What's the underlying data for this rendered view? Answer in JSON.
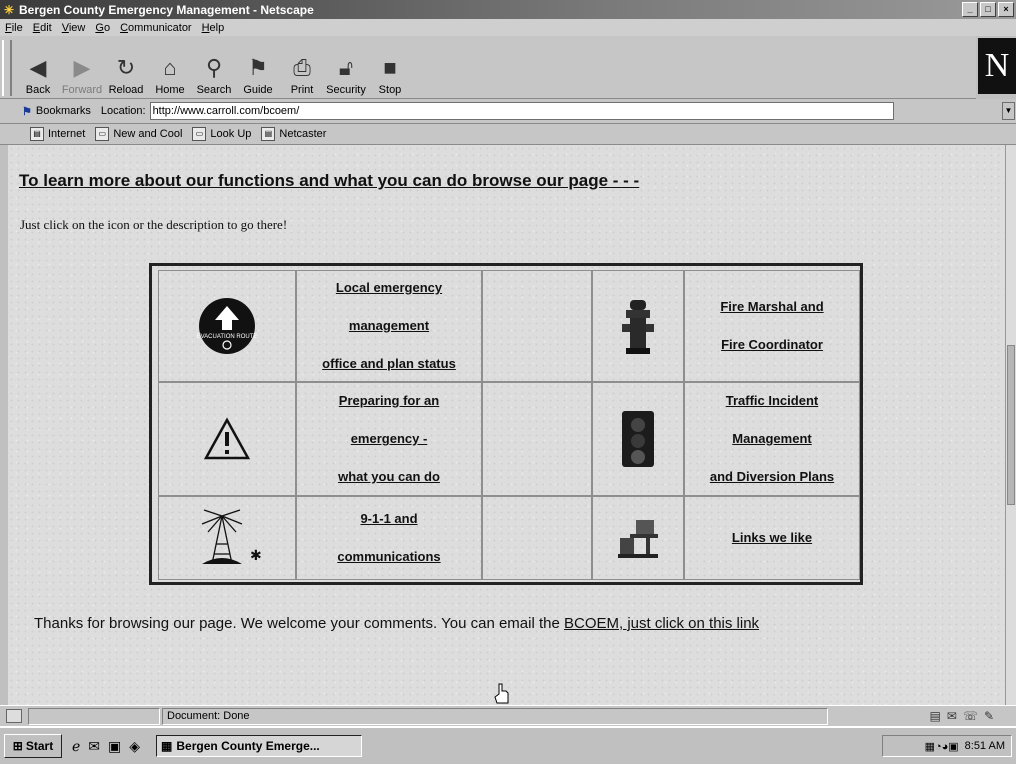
{
  "window": {
    "title": "Bergen County Emergency Management - Netscape",
    "buttons": [
      "_",
      "□",
      "×"
    ]
  },
  "menu": [
    "File",
    "Edit",
    "View",
    "Go",
    "Communicator",
    "Help"
  ],
  "toolbar": [
    {
      "label": "Back",
      "icon": "back-arrow-icon",
      "enabled": true
    },
    {
      "label": "Forward",
      "icon": "forward-arrow-icon",
      "enabled": false
    },
    {
      "label": "Reload",
      "icon": "reload-icon",
      "enabled": true
    },
    {
      "label": "Home",
      "icon": "home-icon",
      "enabled": true
    },
    {
      "label": "Search",
      "icon": "search-icon",
      "enabled": true
    },
    {
      "label": "Guide",
      "icon": "guide-icon",
      "enabled": true
    },
    {
      "label": "Print",
      "icon": "print-icon",
      "enabled": true
    },
    {
      "label": "Security",
      "icon": "lock-icon",
      "enabled": true
    },
    {
      "label": "Stop",
      "icon": "stop-icon",
      "enabled": true
    }
  ],
  "brand_logo": "N",
  "location_bar": {
    "bookmarks_label": "Bookmarks",
    "location_label": "Location:",
    "url": "http://www.carroll.com/bcoem/"
  },
  "personal_toolbar": [
    "Internet",
    "New and Cool",
    "Look Up",
    "Netcaster"
  ],
  "page": {
    "heading": "To learn more about our functions and what you can do browse our page - - -",
    "instruction": "Just click on the icon or the description to go there!",
    "links_table": {
      "rows": [
        {
          "left": {
            "icon": "evacuation-route-icon",
            "icon_text": "EVACUATION ROUTE",
            "lines": [
              "Local emergency",
              "management",
              "office and plan status"
            ]
          },
          "right": {
            "icon": "fire-hydrant-icon",
            "lines": [
              "Fire Marshal and",
              "Fire Coordinator"
            ]
          }
        },
        {
          "left": {
            "icon": "warning-triangle-icon",
            "lines": [
              "Preparing for an",
              "emergency -",
              "what you can do"
            ]
          },
          "right": {
            "icon": "traffic-signal-icon",
            "lines": [
              "Traffic Incident",
              "Management",
              "and Diversion Plans"
            ]
          }
        },
        {
          "left": {
            "icon": "radio-tower-icon",
            "lines": [
              "9-1-1 and",
              "communications"
            ]
          },
          "right": {
            "icon": "computer-desk-icon",
            "lines": [
              "Links we like"
            ]
          }
        }
      ]
    },
    "footer": {
      "text": "Thanks for browsing our page. We welcome your comments. You can email the ",
      "link": "BCOEM, just click on this link"
    }
  },
  "status": {
    "text": "Document: Done"
  },
  "taskbar": {
    "start_label": "Start",
    "task_label": "Bergen County Emerge...",
    "clock": "8:51 AM"
  }
}
